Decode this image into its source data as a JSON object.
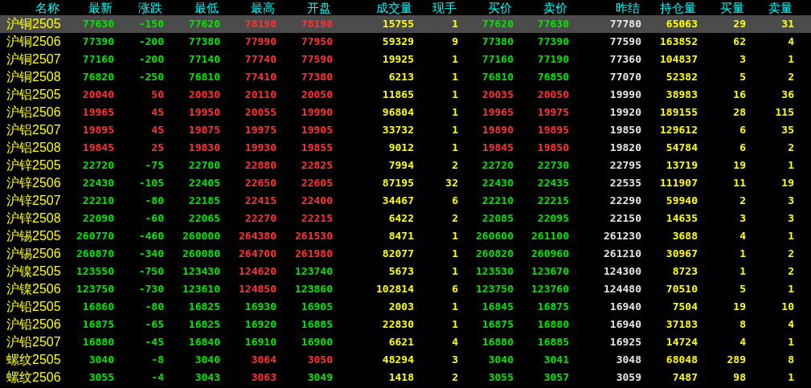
{
  "columns": [
    "名称",
    "最新",
    "涨跌",
    "最低",
    "最高",
    "开盘",
    "成交量",
    "现手",
    "买价",
    "卖价",
    "昨结",
    "持仓量",
    "买量",
    "卖量"
  ],
  "rows": [
    {
      "name": "沪铜2505",
      "selected": true,
      "cells": [
        {
          "text": "77630",
          "kind": "down"
        },
        {
          "text": "-150",
          "kind": "down"
        },
        {
          "text": "77620",
          "kind": "down"
        },
        {
          "text": "78190",
          "kind": "up"
        },
        {
          "text": "78190",
          "kind": "up"
        },
        {
          "text": "15755",
          "kind": "volume"
        },
        {
          "text": "1",
          "kind": "volume"
        },
        {
          "text": "77620",
          "kind": "down"
        },
        {
          "text": "77630",
          "kind": "down"
        },
        {
          "text": "77780",
          "kind": "settle"
        },
        {
          "text": "65063",
          "kind": "volume"
        },
        {
          "text": "29",
          "kind": "volume"
        },
        {
          "text": "31",
          "kind": "volume"
        }
      ]
    },
    {
      "name": "沪铜2506",
      "selected": false,
      "cells": [
        {
          "text": "77390",
          "kind": "down"
        },
        {
          "text": "-200",
          "kind": "down"
        },
        {
          "text": "77380",
          "kind": "down"
        },
        {
          "text": "77990",
          "kind": "up"
        },
        {
          "text": "77950",
          "kind": "up"
        },
        {
          "text": "59329",
          "kind": "volume"
        },
        {
          "text": "9",
          "kind": "volume"
        },
        {
          "text": "77380",
          "kind": "down"
        },
        {
          "text": "77390",
          "kind": "down"
        },
        {
          "text": "77590",
          "kind": "settle"
        },
        {
          "text": "163852",
          "kind": "volume"
        },
        {
          "text": "62",
          "kind": "volume"
        },
        {
          "text": "4",
          "kind": "volume"
        }
      ]
    },
    {
      "name": "沪铜2507",
      "selected": false,
      "cells": [
        {
          "text": "77160",
          "kind": "down"
        },
        {
          "text": "-200",
          "kind": "down"
        },
        {
          "text": "77140",
          "kind": "down"
        },
        {
          "text": "77740",
          "kind": "up"
        },
        {
          "text": "77590",
          "kind": "up"
        },
        {
          "text": "19925",
          "kind": "volume"
        },
        {
          "text": "1",
          "kind": "volume"
        },
        {
          "text": "77160",
          "kind": "down"
        },
        {
          "text": "77190",
          "kind": "down"
        },
        {
          "text": "77360",
          "kind": "settle"
        },
        {
          "text": "104837",
          "kind": "volume"
        },
        {
          "text": "3",
          "kind": "volume"
        },
        {
          "text": "1",
          "kind": "volume"
        }
      ]
    },
    {
      "name": "沪铜2508",
      "selected": false,
      "cells": [
        {
          "text": "76820",
          "kind": "down"
        },
        {
          "text": "-250",
          "kind": "down"
        },
        {
          "text": "76810",
          "kind": "down"
        },
        {
          "text": "77410",
          "kind": "up"
        },
        {
          "text": "77380",
          "kind": "up"
        },
        {
          "text": "6213",
          "kind": "volume"
        },
        {
          "text": "1",
          "kind": "volume"
        },
        {
          "text": "76810",
          "kind": "down"
        },
        {
          "text": "76850",
          "kind": "down"
        },
        {
          "text": "77070",
          "kind": "settle"
        },
        {
          "text": "52382",
          "kind": "volume"
        },
        {
          "text": "5",
          "kind": "volume"
        },
        {
          "text": "2",
          "kind": "volume"
        }
      ]
    },
    {
      "name": "沪铝2505",
      "selected": false,
      "cells": [
        {
          "text": "20040",
          "kind": "up"
        },
        {
          "text": "50",
          "kind": "up"
        },
        {
          "text": "20030",
          "kind": "up"
        },
        {
          "text": "20110",
          "kind": "up"
        },
        {
          "text": "20050",
          "kind": "up"
        },
        {
          "text": "11865",
          "kind": "volume"
        },
        {
          "text": "1",
          "kind": "volume"
        },
        {
          "text": "20035",
          "kind": "up"
        },
        {
          "text": "20050",
          "kind": "up"
        },
        {
          "text": "19990",
          "kind": "settle"
        },
        {
          "text": "38983",
          "kind": "volume"
        },
        {
          "text": "16",
          "kind": "volume"
        },
        {
          "text": "36",
          "kind": "volume"
        }
      ]
    },
    {
      "name": "沪铝2506",
      "selected": false,
      "cells": [
        {
          "text": "19965",
          "kind": "up"
        },
        {
          "text": "45",
          "kind": "up"
        },
        {
          "text": "19950",
          "kind": "up"
        },
        {
          "text": "20055",
          "kind": "up"
        },
        {
          "text": "19990",
          "kind": "up"
        },
        {
          "text": "96804",
          "kind": "volume"
        },
        {
          "text": "1",
          "kind": "volume"
        },
        {
          "text": "19965",
          "kind": "up"
        },
        {
          "text": "19975",
          "kind": "up"
        },
        {
          "text": "19920",
          "kind": "settle"
        },
        {
          "text": "189155",
          "kind": "volume"
        },
        {
          "text": "28",
          "kind": "volume"
        },
        {
          "text": "115",
          "kind": "volume"
        }
      ]
    },
    {
      "name": "沪铝2507",
      "selected": false,
      "cells": [
        {
          "text": "19895",
          "kind": "up"
        },
        {
          "text": "45",
          "kind": "up"
        },
        {
          "text": "19875",
          "kind": "up"
        },
        {
          "text": "19975",
          "kind": "up"
        },
        {
          "text": "19905",
          "kind": "up"
        },
        {
          "text": "33732",
          "kind": "volume"
        },
        {
          "text": "1",
          "kind": "volume"
        },
        {
          "text": "19890",
          "kind": "up"
        },
        {
          "text": "19895",
          "kind": "up"
        },
        {
          "text": "19850",
          "kind": "settle"
        },
        {
          "text": "129612",
          "kind": "volume"
        },
        {
          "text": "6",
          "kind": "volume"
        },
        {
          "text": "35",
          "kind": "volume"
        }
      ]
    },
    {
      "name": "沪铝2508",
      "selected": false,
      "cells": [
        {
          "text": "19845",
          "kind": "up"
        },
        {
          "text": "25",
          "kind": "up"
        },
        {
          "text": "19830",
          "kind": "up"
        },
        {
          "text": "19930",
          "kind": "up"
        },
        {
          "text": "19855",
          "kind": "up"
        },
        {
          "text": "9012",
          "kind": "volume"
        },
        {
          "text": "1",
          "kind": "volume"
        },
        {
          "text": "19845",
          "kind": "up"
        },
        {
          "text": "19850",
          "kind": "up"
        },
        {
          "text": "19820",
          "kind": "settle"
        },
        {
          "text": "54784",
          "kind": "volume"
        },
        {
          "text": "6",
          "kind": "volume"
        },
        {
          "text": "2",
          "kind": "volume"
        }
      ]
    },
    {
      "name": "沪锌2505",
      "selected": false,
      "cells": [
        {
          "text": "22720",
          "kind": "down"
        },
        {
          "text": "-75",
          "kind": "down"
        },
        {
          "text": "22700",
          "kind": "down"
        },
        {
          "text": "22880",
          "kind": "up"
        },
        {
          "text": "22825",
          "kind": "up"
        },
        {
          "text": "7994",
          "kind": "volume"
        },
        {
          "text": "2",
          "kind": "volume"
        },
        {
          "text": "22720",
          "kind": "down"
        },
        {
          "text": "22730",
          "kind": "down"
        },
        {
          "text": "22795",
          "kind": "settle"
        },
        {
          "text": "13719",
          "kind": "volume"
        },
        {
          "text": "19",
          "kind": "volume"
        },
        {
          "text": "1",
          "kind": "volume"
        }
      ]
    },
    {
      "name": "沪锌2506",
      "selected": false,
      "cells": [
        {
          "text": "22430",
          "kind": "down"
        },
        {
          "text": "-105",
          "kind": "down"
        },
        {
          "text": "22405",
          "kind": "down"
        },
        {
          "text": "22650",
          "kind": "up"
        },
        {
          "text": "22605",
          "kind": "up"
        },
        {
          "text": "87195",
          "kind": "volume"
        },
        {
          "text": "32",
          "kind": "volume"
        },
        {
          "text": "22430",
          "kind": "down"
        },
        {
          "text": "22435",
          "kind": "down"
        },
        {
          "text": "22535",
          "kind": "settle"
        },
        {
          "text": "111907",
          "kind": "volume"
        },
        {
          "text": "11",
          "kind": "volume"
        },
        {
          "text": "19",
          "kind": "volume"
        }
      ]
    },
    {
      "name": "沪锌2507",
      "selected": false,
      "cells": [
        {
          "text": "22210",
          "kind": "down"
        },
        {
          "text": "-80",
          "kind": "down"
        },
        {
          "text": "22185",
          "kind": "down"
        },
        {
          "text": "22415",
          "kind": "up"
        },
        {
          "text": "22400",
          "kind": "up"
        },
        {
          "text": "34467",
          "kind": "volume"
        },
        {
          "text": "6",
          "kind": "volume"
        },
        {
          "text": "22210",
          "kind": "down"
        },
        {
          "text": "22215",
          "kind": "down"
        },
        {
          "text": "22290",
          "kind": "settle"
        },
        {
          "text": "59940",
          "kind": "volume"
        },
        {
          "text": "2",
          "kind": "volume"
        },
        {
          "text": "3",
          "kind": "volume"
        }
      ]
    },
    {
      "name": "沪锌2508",
      "selected": false,
      "cells": [
        {
          "text": "22090",
          "kind": "down"
        },
        {
          "text": "-60",
          "kind": "down"
        },
        {
          "text": "22065",
          "kind": "down"
        },
        {
          "text": "22270",
          "kind": "up"
        },
        {
          "text": "22215",
          "kind": "up"
        },
        {
          "text": "6422",
          "kind": "volume"
        },
        {
          "text": "2",
          "kind": "volume"
        },
        {
          "text": "22085",
          "kind": "down"
        },
        {
          "text": "22095",
          "kind": "down"
        },
        {
          "text": "22150",
          "kind": "settle"
        },
        {
          "text": "14635",
          "kind": "volume"
        },
        {
          "text": "3",
          "kind": "volume"
        },
        {
          "text": "3",
          "kind": "volume"
        }
      ]
    },
    {
      "name": "沪锡2505",
      "selected": false,
      "cells": [
        {
          "text": "260770",
          "kind": "down"
        },
        {
          "text": "-460",
          "kind": "down"
        },
        {
          "text": "260000",
          "kind": "down"
        },
        {
          "text": "264380",
          "kind": "up"
        },
        {
          "text": "261530",
          "kind": "up"
        },
        {
          "text": "8471",
          "kind": "volume"
        },
        {
          "text": "1",
          "kind": "volume"
        },
        {
          "text": "260600",
          "kind": "down"
        },
        {
          "text": "261100",
          "kind": "down"
        },
        {
          "text": "261230",
          "kind": "settle"
        },
        {
          "text": "3688",
          "kind": "volume"
        },
        {
          "text": "4",
          "kind": "volume"
        },
        {
          "text": "1",
          "kind": "volume"
        }
      ]
    },
    {
      "name": "沪锡2506",
      "selected": false,
      "cells": [
        {
          "text": "260870",
          "kind": "down"
        },
        {
          "text": "-340",
          "kind": "down"
        },
        {
          "text": "260080",
          "kind": "down"
        },
        {
          "text": "264700",
          "kind": "up"
        },
        {
          "text": "261980",
          "kind": "up"
        },
        {
          "text": "82077",
          "kind": "volume"
        },
        {
          "text": "1",
          "kind": "volume"
        },
        {
          "text": "260820",
          "kind": "down"
        },
        {
          "text": "260960",
          "kind": "down"
        },
        {
          "text": "261210",
          "kind": "settle"
        },
        {
          "text": "30967",
          "kind": "volume"
        },
        {
          "text": "1",
          "kind": "volume"
        },
        {
          "text": "2",
          "kind": "volume"
        }
      ]
    },
    {
      "name": "沪镍2505",
      "selected": false,
      "cells": [
        {
          "text": "123550",
          "kind": "down"
        },
        {
          "text": "-750",
          "kind": "down"
        },
        {
          "text": "123430",
          "kind": "down"
        },
        {
          "text": "124620",
          "kind": "up"
        },
        {
          "text": "123740",
          "kind": "down"
        },
        {
          "text": "5673",
          "kind": "volume"
        },
        {
          "text": "1",
          "kind": "volume"
        },
        {
          "text": "123530",
          "kind": "down"
        },
        {
          "text": "123670",
          "kind": "down"
        },
        {
          "text": "124300",
          "kind": "settle"
        },
        {
          "text": "8723",
          "kind": "volume"
        },
        {
          "text": "1",
          "kind": "volume"
        },
        {
          "text": "2",
          "kind": "volume"
        }
      ]
    },
    {
      "name": "沪镍2506",
      "selected": false,
      "cells": [
        {
          "text": "123750",
          "kind": "down"
        },
        {
          "text": "-730",
          "kind": "down"
        },
        {
          "text": "123610",
          "kind": "down"
        },
        {
          "text": "124850",
          "kind": "up"
        },
        {
          "text": "123860",
          "kind": "down"
        },
        {
          "text": "102814",
          "kind": "volume"
        },
        {
          "text": "6",
          "kind": "volume"
        },
        {
          "text": "123750",
          "kind": "down"
        },
        {
          "text": "123760",
          "kind": "down"
        },
        {
          "text": "124480",
          "kind": "settle"
        },
        {
          "text": "70510",
          "kind": "volume"
        },
        {
          "text": "5",
          "kind": "volume"
        },
        {
          "text": "1",
          "kind": "volume"
        }
      ]
    },
    {
      "name": "沪铅2505",
      "selected": false,
      "cells": [
        {
          "text": "16860",
          "kind": "down"
        },
        {
          "text": "-80",
          "kind": "down"
        },
        {
          "text": "16825",
          "kind": "down"
        },
        {
          "text": "16930",
          "kind": "down"
        },
        {
          "text": "16905",
          "kind": "down"
        },
        {
          "text": "2003",
          "kind": "volume"
        },
        {
          "text": "1",
          "kind": "volume"
        },
        {
          "text": "16845",
          "kind": "down"
        },
        {
          "text": "16875",
          "kind": "down"
        },
        {
          "text": "16940",
          "kind": "settle"
        },
        {
          "text": "7504",
          "kind": "volume"
        },
        {
          "text": "19",
          "kind": "volume"
        },
        {
          "text": "10",
          "kind": "volume"
        }
      ]
    },
    {
      "name": "沪铅2506",
      "selected": false,
      "cells": [
        {
          "text": "16875",
          "kind": "down"
        },
        {
          "text": "-65",
          "kind": "down"
        },
        {
          "text": "16825",
          "kind": "down"
        },
        {
          "text": "16920",
          "kind": "down"
        },
        {
          "text": "16885",
          "kind": "down"
        },
        {
          "text": "22830",
          "kind": "volume"
        },
        {
          "text": "1",
          "kind": "volume"
        },
        {
          "text": "16875",
          "kind": "down"
        },
        {
          "text": "16880",
          "kind": "down"
        },
        {
          "text": "16940",
          "kind": "settle"
        },
        {
          "text": "37183",
          "kind": "volume"
        },
        {
          "text": "8",
          "kind": "volume"
        },
        {
          "text": "4",
          "kind": "volume"
        }
      ]
    },
    {
      "name": "沪铅2507",
      "selected": false,
      "cells": [
        {
          "text": "16880",
          "kind": "down"
        },
        {
          "text": "-45",
          "kind": "down"
        },
        {
          "text": "16840",
          "kind": "down"
        },
        {
          "text": "16910",
          "kind": "down"
        },
        {
          "text": "16900",
          "kind": "down"
        },
        {
          "text": "6621",
          "kind": "volume"
        },
        {
          "text": "4",
          "kind": "volume"
        },
        {
          "text": "16880",
          "kind": "down"
        },
        {
          "text": "16885",
          "kind": "down"
        },
        {
          "text": "16925",
          "kind": "settle"
        },
        {
          "text": "14724",
          "kind": "volume"
        },
        {
          "text": "4",
          "kind": "volume"
        },
        {
          "text": "1",
          "kind": "volume"
        }
      ]
    },
    {
      "name": "螺纹2505",
      "selected": false,
      "cells": [
        {
          "text": "3040",
          "kind": "down"
        },
        {
          "text": "-8",
          "kind": "down"
        },
        {
          "text": "3040",
          "kind": "down"
        },
        {
          "text": "3064",
          "kind": "up"
        },
        {
          "text": "3050",
          "kind": "up"
        },
        {
          "text": "48294",
          "kind": "volume"
        },
        {
          "text": "3",
          "kind": "volume"
        },
        {
          "text": "3040",
          "kind": "down"
        },
        {
          "text": "3041",
          "kind": "down"
        },
        {
          "text": "3048",
          "kind": "settle"
        },
        {
          "text": "68048",
          "kind": "volume"
        },
        {
          "text": "289",
          "kind": "volume"
        },
        {
          "text": "8",
          "kind": "volume"
        }
      ]
    },
    {
      "name": "螺纹2506",
      "selected": false,
      "cells": [
        {
          "text": "3055",
          "kind": "down"
        },
        {
          "text": "-4",
          "kind": "down"
        },
        {
          "text": "3043",
          "kind": "down"
        },
        {
          "text": "3063",
          "kind": "up"
        },
        {
          "text": "3049",
          "kind": "down"
        },
        {
          "text": "1418",
          "kind": "volume"
        },
        {
          "text": "2",
          "kind": "volume"
        },
        {
          "text": "3055",
          "kind": "down"
        },
        {
          "text": "3057",
          "kind": "down"
        },
        {
          "text": "3059",
          "kind": "settle"
        },
        {
          "text": "7487",
          "kind": "volume"
        },
        {
          "text": "98",
          "kind": "volume"
        },
        {
          "text": "1",
          "kind": "volume"
        }
      ]
    }
  ]
}
